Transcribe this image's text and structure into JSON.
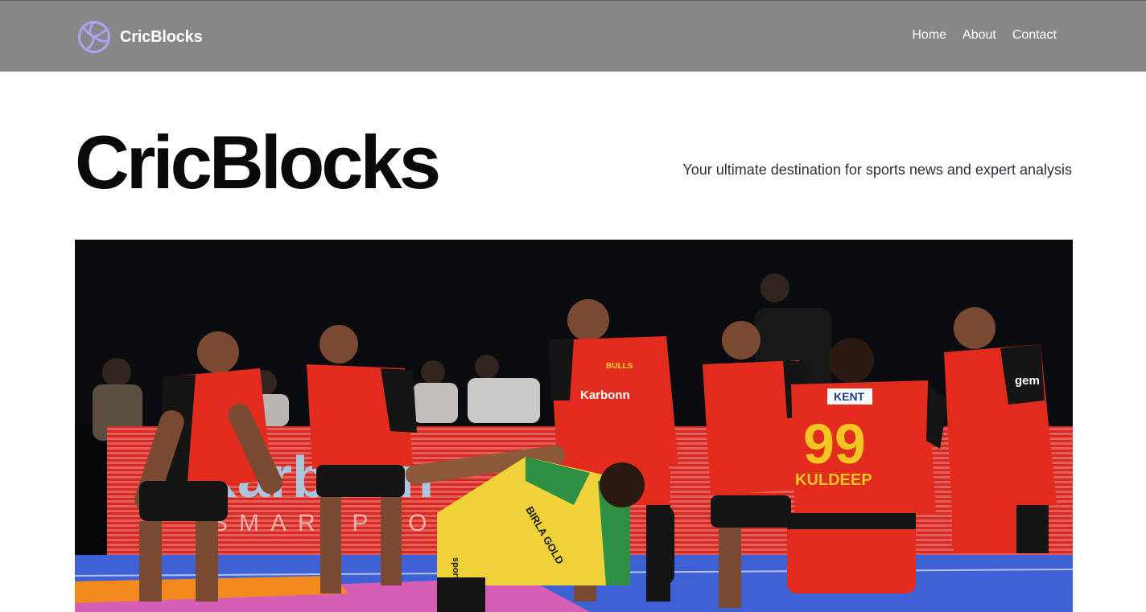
{
  "header": {
    "brand_name": "CricBlocks",
    "logo_icon": "volleyball-icon",
    "nav": [
      {
        "label": "Home"
      },
      {
        "label": "About"
      },
      {
        "label": "Contact"
      }
    ]
  },
  "hero": {
    "title": "CricBlocks",
    "tagline": "Your ultimate destination for sports news and expert analysis"
  },
  "photo": {
    "banner_texts": [
      "Karbonn",
      "SMARTPHONES"
    ],
    "jersey_texts": [
      "Karbonn",
      "KENT",
      "KULDEEP",
      "99",
      "BULLS",
      "gem",
      "BIRLA GOLD",
      "sportsun"
    ],
    "colors": {
      "nav_bg": "#878787",
      "logo_accent": "#a9a2ee",
      "bulls_red": "#e22c1e",
      "bulls_black": "#151515",
      "pirates_yellow": "#efd23a",
      "pirates_green": "#2e8f45",
      "mat_blue": "#3e62d6",
      "mat_pink": "#d45fb4",
      "mat_orange": "#f28a1d"
    }
  }
}
